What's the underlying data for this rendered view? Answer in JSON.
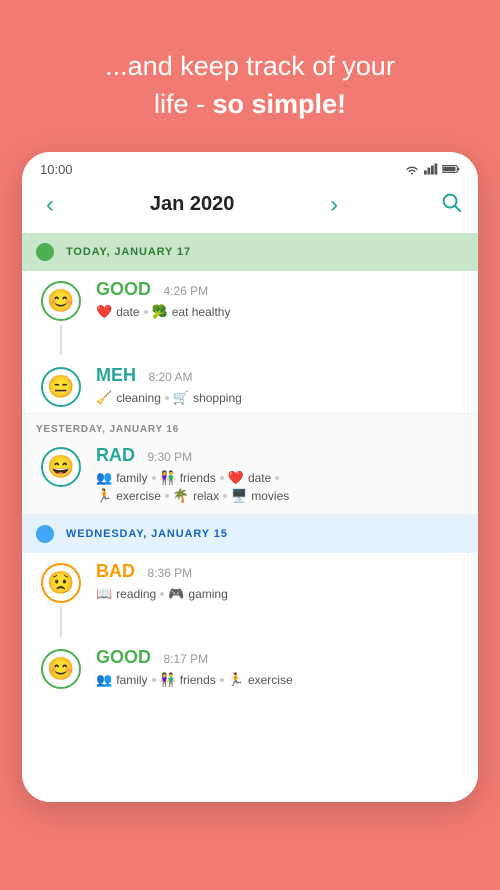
{
  "header": {
    "line1": "...and keep track of your",
    "line2": "life - ",
    "line2_bold": "so simple!"
  },
  "status_bar": {
    "time": "10:00"
  },
  "calendar": {
    "month_label": "Jan 2020",
    "prev_label": "‹",
    "next_label": "›"
  },
  "days": [
    {
      "id": "today",
      "label": "TODAY, JANUARY 17",
      "type": "today",
      "entries": [
        {
          "mood": "GOOD",
          "mood_key": "green",
          "time": "4:26 PM",
          "tags": [
            {
              "icon": "❤️",
              "label": "date"
            },
            {
              "icon": "🥦",
              "label": "eat healthy"
            }
          ]
        },
        {
          "mood": "MEH",
          "mood_key": "teal",
          "time": "8:20 AM",
          "tags": [
            {
              "icon": "🧹",
              "label": "cleaning"
            },
            {
              "icon": "🛒",
              "label": "shopping"
            }
          ]
        }
      ]
    },
    {
      "id": "yesterday",
      "label": "YESTERDAY, JANUARY 16",
      "type": "yesterday",
      "entries": [
        {
          "mood": "RAD",
          "mood_key": "teal",
          "time": "9:30 PM",
          "tags": [
            {
              "icon": "👥",
              "label": "family"
            },
            {
              "icon": "👫",
              "label": "friends"
            },
            {
              "icon": "❤️",
              "label": "date"
            },
            {
              "icon": "🏃",
              "label": "exercise"
            },
            {
              "icon": "🌴",
              "label": "relax"
            },
            {
              "icon": "🖥️",
              "label": "movies"
            }
          ]
        }
      ]
    },
    {
      "id": "wednesday",
      "label": "WEDNESDAY, JANUARY 15",
      "type": "wednesday",
      "entries": [
        {
          "mood": "BAD",
          "mood_key": "orange",
          "time": "8:36 PM",
          "tags": [
            {
              "icon": "📖",
              "label": "reading"
            },
            {
              "icon": "🎮",
              "label": "gaming"
            }
          ]
        },
        {
          "mood": "GOOD",
          "mood_key": "green",
          "time": "8:17 PM",
          "tags": [
            {
              "icon": "👥",
              "label": "family"
            },
            {
              "icon": "👫",
              "label": "friends"
            },
            {
              "icon": "🏃",
              "label": "exercise"
            }
          ]
        }
      ]
    }
  ],
  "faces": {
    "GOOD": "😊",
    "MEH": "😑",
    "RAD": "😄",
    "BAD": "😟"
  }
}
